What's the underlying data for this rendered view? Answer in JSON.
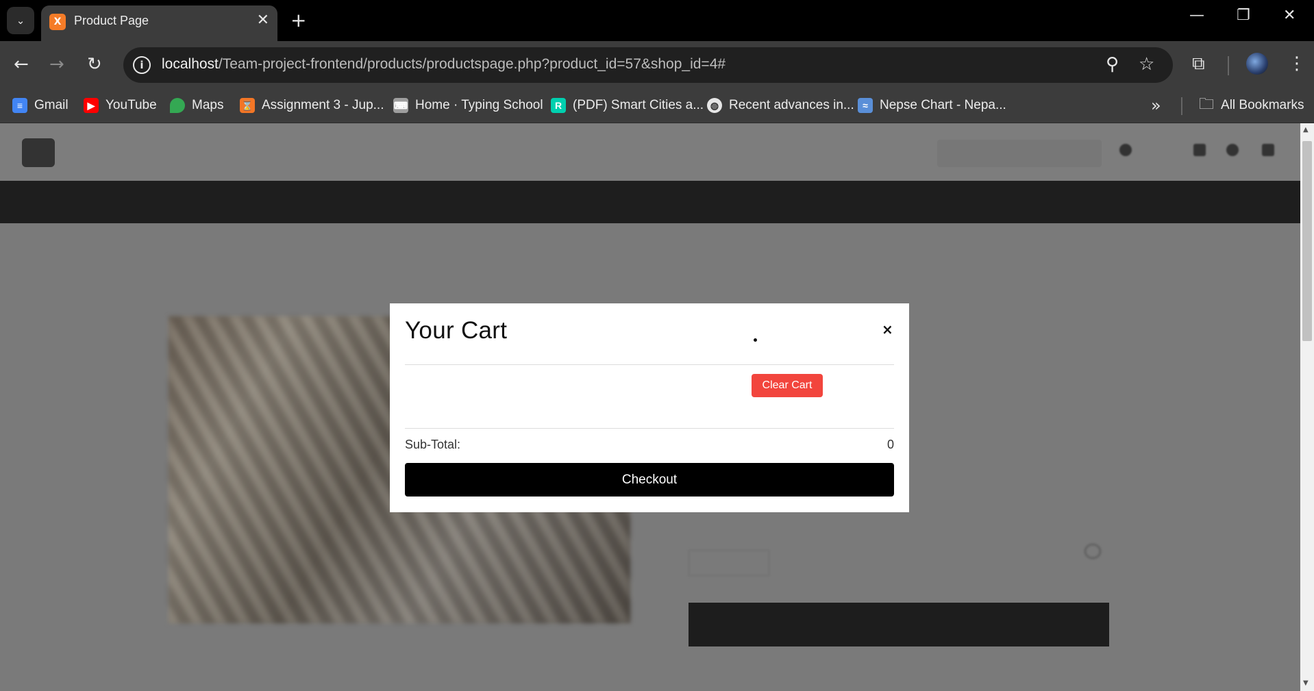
{
  "browser": {
    "tab": {
      "title": "Product Page",
      "favicon_letter": "X"
    },
    "url": {
      "host": "localhost",
      "path": "/Team-project-frontend/products/productspage.php?product_id=57&shop_id=4#"
    },
    "bookmarks": [
      {
        "label": "Gmail",
        "icon": "gmail-icon",
        "color": "#4285f4"
      },
      {
        "label": "YouTube",
        "icon": "youtube-icon",
        "color": "#ff0000"
      },
      {
        "label": "Maps",
        "icon": "maps-icon",
        "color": "#34a853"
      },
      {
        "label": "Assignment 3 - Jup...",
        "icon": "jupyter-icon",
        "color": "#f37626"
      },
      {
        "label": "Home · Typing School",
        "icon": "typing-icon",
        "color": "#9e9e9e"
      },
      {
        "label": "(PDF) Smart Cities a...",
        "icon": "researchgate-icon",
        "color": "#00d0af"
      },
      {
        "label": "Recent advances in...",
        "icon": "globe-icon",
        "color": "#e6e6e6"
      },
      {
        "label": "Nepse Chart - Nepa...",
        "icon": "nepse-icon",
        "color": "#5a8fd8"
      }
    ],
    "all_bookmarks_label": "All Bookmarks"
  },
  "cart_modal": {
    "title": "Your Cart",
    "close_label": "×",
    "clear_label": "Clear Cart",
    "subtotal_label": "Sub-Total:",
    "subtotal_value": "0",
    "checkout_label": "Checkout"
  }
}
